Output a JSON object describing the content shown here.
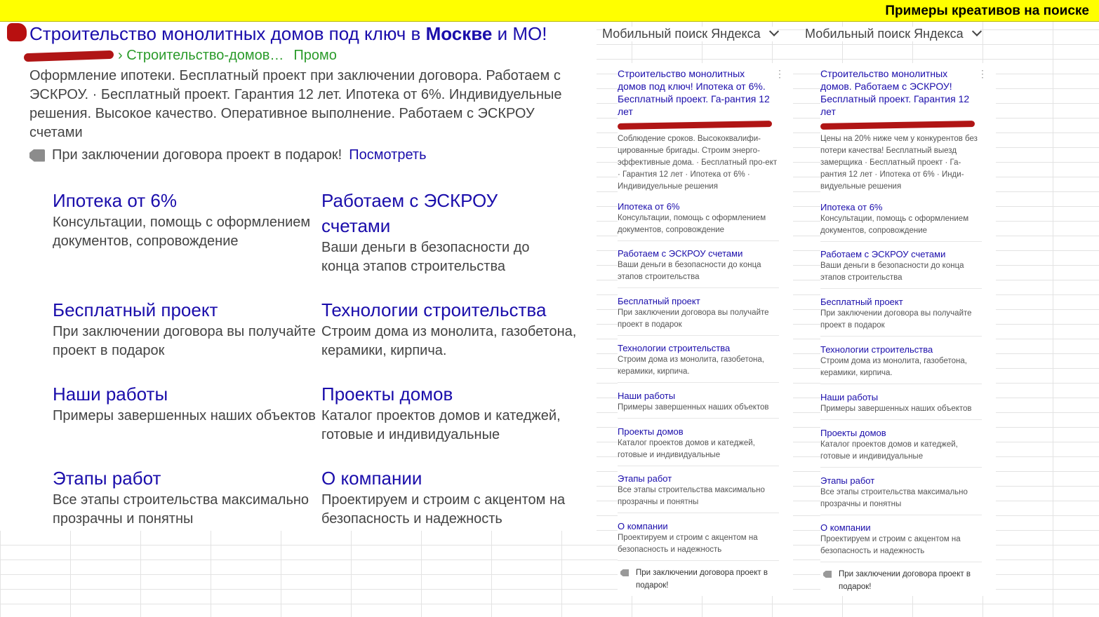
{
  "header": {
    "title": "Примеры креативов на поиске"
  },
  "desktop": {
    "ad_title_pre": "Строительство монолитных домов под ключ в ",
    "ad_title_bold": "Москве",
    "ad_title_post": " и МО!",
    "breadcrumb": "› Строительство-домов…",
    "promo": "Промо",
    "description": "Оформление ипотеки. Бесплатный проект при заключении договора. Работаем с ЭСКРОУ. · Бесплатный проект. Гарантия 12 лет. Ипотека от 6%. Индивидуельные решения. Высокое качество. Оперативное выполнение. Работаем с ЭСКРОУ счетами",
    "callout": "При заключении договора проект в подарок!",
    "callout_link": "Посмотреть",
    "sitelinks": [
      {
        "title": "Ипотека от 6%",
        "desc": "Консультации, помощь с оформлением документов, сопровождение"
      },
      {
        "title": "Работаем с ЭСКРОУ счетами",
        "desc": "Ваши деньги в безопасности до конца этапов строительства"
      },
      {
        "title": "Бесплатный проект",
        "desc": "При заключении договора вы получайте проект в подарок"
      },
      {
        "title": "Технологии строительства",
        "desc": "Строим дома из монолита, газобетона, керамики, кирпича."
      },
      {
        "title": "Наши работы",
        "desc": "Примеры завершенных наших объектов"
      },
      {
        "title": "Проекты домов",
        "desc": "Каталог проектов домов и катеджей, готовые и индивидуальные"
      },
      {
        "title": "Этапы работ",
        "desc": "Все этапы строительства максимально прозрачны и понятны"
      },
      {
        "title": "О компании",
        "desc": "Проектируем и строим с акцентом на безопасность и надежность"
      }
    ]
  },
  "mobile": [
    {
      "header": "Мобильный поиск Яндекса",
      "title": "Строительство монолитных домов под ключ! Ипотека от 6%. Бесплатный проект. Га-рантия 12 лет",
      "dots": "⋮",
      "description": "Соблюдение сроков. Высококвалифи-цированные бригады. Строим энерго-эффективные дома. · Бесплатный про-ект · Гарантия 12 лет · Ипотека от 6% · Индивидуельные решения",
      "sitelinks": [
        {
          "title": "Ипотека от 6%",
          "desc": "Консультации, помощь с оформлением документов, сопровождение"
        },
        {
          "title": "Работаем с ЭСКРОУ счетами",
          "desc": "Ваши деньги в безопасности до конца этапов строительства"
        },
        {
          "title": "Бесплатный проект",
          "desc": "При заключении договора вы получайте проект в подарок"
        },
        {
          "title": "Технологии строительства",
          "desc": "Строим дома из монолита, газобетона, керамики, кирпича."
        },
        {
          "title": "Наши работы",
          "desc": "Примеры завершенных наших объектов"
        },
        {
          "title": "Проекты домов",
          "desc": "Каталог проектов домов и катеджей, готовые и индивидуальные"
        },
        {
          "title": "Этапы работ",
          "desc": "Все этапы строительства максимально прозрачны и понятны"
        },
        {
          "title": "О компании",
          "desc": "Проектируем и строим с акцентом на безопасность и надежность"
        }
      ],
      "callout": "При заключении договора проект в подарок!"
    },
    {
      "header": "Мобильный поиск Яндекса",
      "title": "Строительство монолитных домов. Работаем с ЭСКРОУ! Бесплатный проект. Гарантия 12 лет",
      "dots": "⋮",
      "description": "Цены на 20% ниже чем у конкурентов без потери качества! Бесплатный выезд замерщика · Бесплатный проект · Га-рантия 12 лет · Ипотека от 6% · Инди-видуельные решения",
      "sitelinks": [
        {
          "title": "Ипотека от 6%",
          "desc": "Консультации, помощь с оформлением документов, сопровождение"
        },
        {
          "title": "Работаем с ЭСКРОУ счетами",
          "desc": "Ваши деньги в безопасности до конца этапов строительства"
        },
        {
          "title": "Бесплатный проект",
          "desc": "При заключении договора вы получайте проект в подарок"
        },
        {
          "title": "Технологии строительства",
          "desc": "Строим дома из монолита, газобетона, керамики, кирпича."
        },
        {
          "title": "Наши работы",
          "desc": "Примеры завершенных наших объектов"
        },
        {
          "title": "Проекты домов",
          "desc": "Каталог проектов домов и катеджей, готовые и индивидуальные"
        },
        {
          "title": "Этапы работ",
          "desc": "Все этапы строительства максимально прозрачны и понятны"
        },
        {
          "title": "О компании",
          "desc": "Проектируем и строим с акцентом на безопасность и надежность"
        }
      ],
      "callout": "При заключении договора проект в подарок!"
    }
  ]
}
